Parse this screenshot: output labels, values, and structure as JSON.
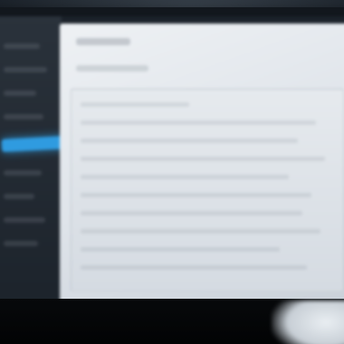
{
  "scene": {
    "kind": "blurred monitor photo",
    "colors": {
      "bezel": "#12171d",
      "sidebar": "#2a323b",
      "accent": "#2f9be0",
      "window": "#eef1f4",
      "panel": "#dfe4ea"
    }
  },
  "sidebar": {
    "selected_item": ""
  },
  "window": {
    "title": "",
    "toolbar_label": ""
  }
}
